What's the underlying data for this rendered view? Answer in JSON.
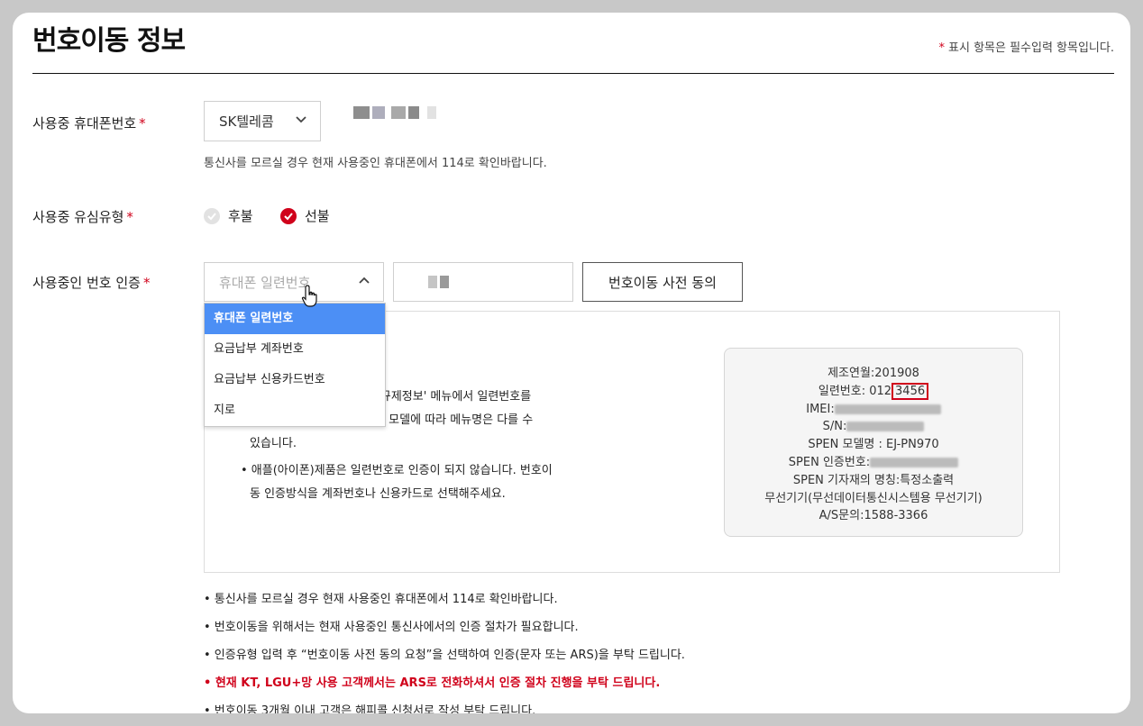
{
  "page": {
    "title": "번호이동 정보",
    "required_note": "표시 항목은 필수입력 항목입니다.",
    "required_mark": "*"
  },
  "carrier_row": {
    "label": "사용중 휴대폰번호",
    "selected_carrier": "SK텔레콤",
    "helper": "통신사를 모르실 경우 현재 사용중인 휴대폰에서 114로 확인바랍니다."
  },
  "usim_row": {
    "label": "사용중 유심유형",
    "options": [
      {
        "label": "후불",
        "selected": false
      },
      {
        "label": "선불",
        "selected": true
      }
    ]
  },
  "auth_row": {
    "label": "사용중인 번호 인증",
    "auth_type_placeholder": "휴대폰 일련번호",
    "consent_button": "번호이동 사전 동의",
    "dropdown_options": [
      "휴대폰 일련번호",
      "요금납부 계좌번호",
      "요금납부 신용카드번호",
      "지로"
    ],
    "dropdown_active_index": 0
  },
  "info_box": {
    "line1": "ㄴ>규제정보' 메뉴에서 일련번호를",
    "line2": "사 및 모델에 따라 메뉴명은 다를 수",
    "line3": "있습니다.",
    "line4a": "• 애플(아이폰)제품은 일련번호로 인증이 되지 않습니다. 번호이",
    "line4b": "동 인증방식을 계좌번호나 신용카드로 선택해주세요."
  },
  "sample_label": {
    "manufacture": "제조연월:201908",
    "serial_prefix": "일련번호: 012",
    "serial_highlight": "3456",
    "imei_label": "IMEI:",
    "sn_label": "S/N:",
    "spen_model": "SPEN 모델명 : EJ-PN970",
    "spen_cert_label": "SPEN 인증번호:",
    "spen_name": "SPEN 기자재의 명칭:특정소출력",
    "wireless": "무선기기(무선데이터통신시스템용 무선기기)",
    "as_contact": "A/S문의:1588-3366"
  },
  "notes": [
    {
      "text": "• 통신사를 모르실 경우 현재 사용중인 휴대폰에서 114로 확인바랍니다.",
      "emphasis": false
    },
    {
      "text": "• 번호이동을 위해서는 현재 사용중인 통신사에서의 인증 절차가 필요합니다.",
      "emphasis": false
    },
    {
      "text": "• 인증유형 입력 후 “번호이동 사전 동의 요청”을 선택하여 인증(문자 또는 ARS)을 부탁 드립니다.",
      "emphasis": false
    },
    {
      "text": "• 현재 KT, LGU+망 사용 고객께서는 ARS로 전화하셔서 인증 절차 진행을 부탁 드립니다.",
      "emphasis": true
    },
    {
      "text": "• 번호이동 3개월 이내 고객은 해피콜 신청서로 작성 부탁 드립니다.",
      "emphasis": false
    }
  ],
  "colors": {
    "accent": "#d0021b",
    "dropdown_active": "#4c8ff5"
  }
}
